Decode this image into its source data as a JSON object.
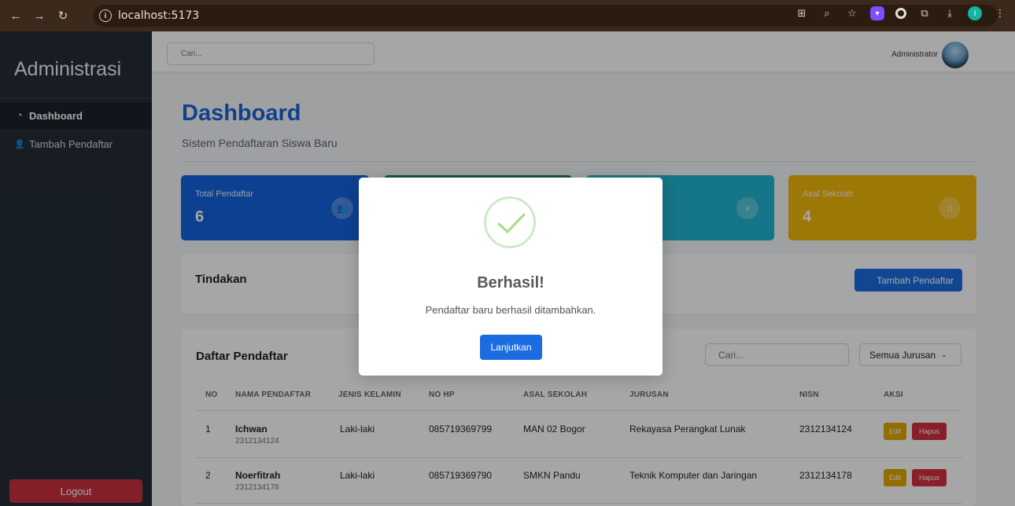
{
  "browser": {
    "url": "localhost:5173"
  },
  "sidebar": {
    "brand": "Administrasi",
    "items": [
      {
        "label": "Dashboard",
        "icon": "tachometer-icon",
        "active": true
      },
      {
        "label": "Tambah Pendaftar",
        "icon": "user-plus-icon",
        "active": false
      }
    ],
    "logout_label": "Logout"
  },
  "topbar": {
    "search_placeholder": "Cari...",
    "user_name": "Administrator"
  },
  "page": {
    "title": "Dashboard",
    "subtitle": "Sistem Pendaftaran Siswa Baru"
  },
  "stats": [
    {
      "label": "Total Pendaftar",
      "value": "6",
      "color": "#1663e0",
      "icon": "users-icon"
    },
    {
      "label": "",
      "value": "",
      "color": "#198754",
      "icon": "male-icon"
    },
    {
      "label": "",
      "value": "",
      "color": "#1fb5d1",
      "icon": "female-icon"
    },
    {
      "label": "Asal Sekolah",
      "value": "4",
      "color": "#f0b90b",
      "icon": "school-icon"
    }
  ],
  "actions_card": {
    "title": "Tindakan",
    "add_button": "Tambah Pendaftar"
  },
  "list_card": {
    "title": "Daftar Pendaftar",
    "search_placeholder": "Cari...",
    "filter_value": "Semua Jurusan",
    "columns": [
      "NO",
      "NAMA PENDAFTAR",
      "JENIS KELAMIN",
      "NO HP",
      "ASAL SEKOLAH",
      "JURUSAN",
      "NISN",
      "AKSI"
    ],
    "rows": [
      {
        "no": "1",
        "name": "Ichwan",
        "nisn_sub": "2312134124",
        "gender": "Laki-laki",
        "phone": "085719369799",
        "school": "MAN 02 Bogor",
        "major": "Rekayasa Perangkat Lunak",
        "nisn": "2312134124"
      },
      {
        "no": "2",
        "name": "Noerfitrah",
        "nisn_sub": "2312134178",
        "gender": "Laki-laki",
        "phone": "085719369790",
        "school": "SMKN Pandu",
        "major": "Teknik Komputer dan Jaringan",
        "nisn": "2312134178"
      }
    ],
    "edit_label": "Edit",
    "delete_label": "Hapus"
  },
  "modal": {
    "title": "Berhasil!",
    "message": "Pendaftar baru berhasil ditambahkan.",
    "button": "Lanjutkan",
    "icon": "success-check-icon"
  },
  "colors": {
    "primary": "#1a6ce0",
    "sidebar": "#242d37",
    "danger": "#d3303f",
    "warning": "#e0a800"
  }
}
